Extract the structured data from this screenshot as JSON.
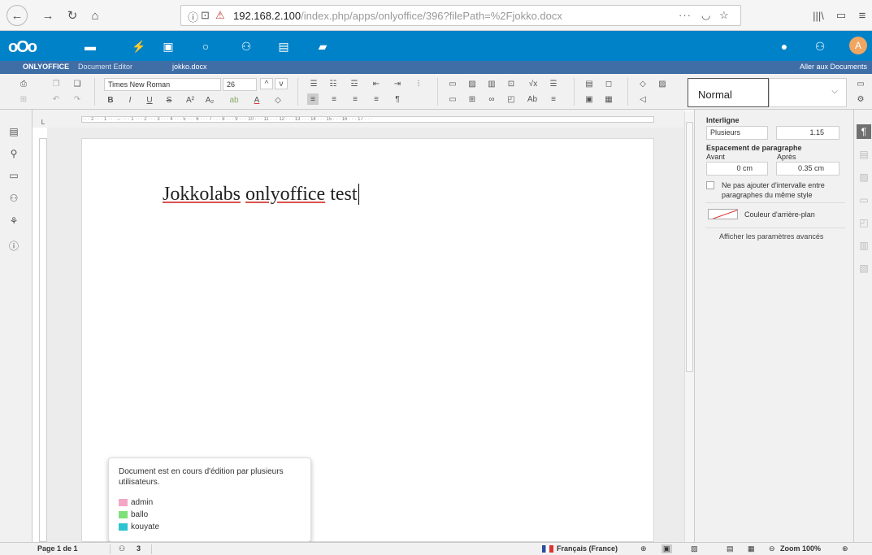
{
  "browser": {
    "url_host": "192.168.2.100",
    "url_path": "/index.php/apps/onlyoffice/396?filePath=%2Fjokko.docx",
    "menu_dots": "···",
    "icons": [
      "back-icon",
      "forward-icon",
      "reload-icon",
      "home-icon",
      "info-icon",
      "bookmark-icon",
      "library-icon",
      "sidebar-icon",
      "menu-icon"
    ]
  },
  "nextcloud": {
    "logo": "oOo",
    "apps": [
      "files-icon",
      "activity-icon",
      "gallery-icon",
      "search-icon",
      "contacts-icon",
      "calendar-icon",
      "deck-icon"
    ],
    "avatar_letter": "A",
    "accent": "#0082c9"
  },
  "onlyoffice": {
    "brand": "ONLYOFFICE",
    "editor_label": "Document Editor",
    "file_name": "jokko.docx",
    "goto_docs": "Aller aux Documents",
    "title_bar_color": "#3f6ea7"
  },
  "toolbar": {
    "font_name": "Times New Roman",
    "font_size": "26",
    "bold": "B",
    "italic": "I",
    "underline": "U",
    "strike": "S",
    "superscript": "A²",
    "subscript": "A₂",
    "style_name": "Normal"
  },
  "ruler": {
    "h_ticks": "· · · 2 · · · 1 · · · ⌵ · · · 1 · · · 2 · · · 3 · · · 4 · · · 5 · · · 6 · · · 7 · · · 8 · · · 9 · · · 10 · · · 11 · · · 12 · · · 13 · · · 14 · · · 15 · · · 16 · · · 17 · · ·"
  },
  "document": {
    "word1": "Jokkolabs",
    "word2": "onlyoffice",
    "word3": "test"
  },
  "paragraph_panel": {
    "line_spacing_label": "Interligne",
    "line_spacing_type": "Plusieurs",
    "line_spacing_value": "1.15",
    "spacing_label": "Espacement de paragraphe",
    "before_label": "Avant",
    "after_label": "Après",
    "before_value": "0 cm",
    "after_value": "0.35 cm",
    "no_interval_label": "Ne pas ajouter d'intervalle entre paragraphes du même style",
    "no_interval_checked": false,
    "bg_color_label": "Couleur d'arrière-plan",
    "advanced_link": "Afficher les paramètres avancés"
  },
  "co_editing_popup": {
    "message": "Document est en cours d'édition par plusieurs utilisateurs.",
    "users": [
      {
        "name": "admin",
        "color": "#f4a7c4"
      },
      {
        "name": "ballo",
        "color": "#7ee07a"
      },
      {
        "name": "kouyate",
        "color": "#2cc4cf"
      }
    ]
  },
  "statusbar": {
    "page_info": "Page 1 de 1",
    "users_count": "3",
    "language": "Français (France)",
    "zoom": "Zoom 100%"
  }
}
